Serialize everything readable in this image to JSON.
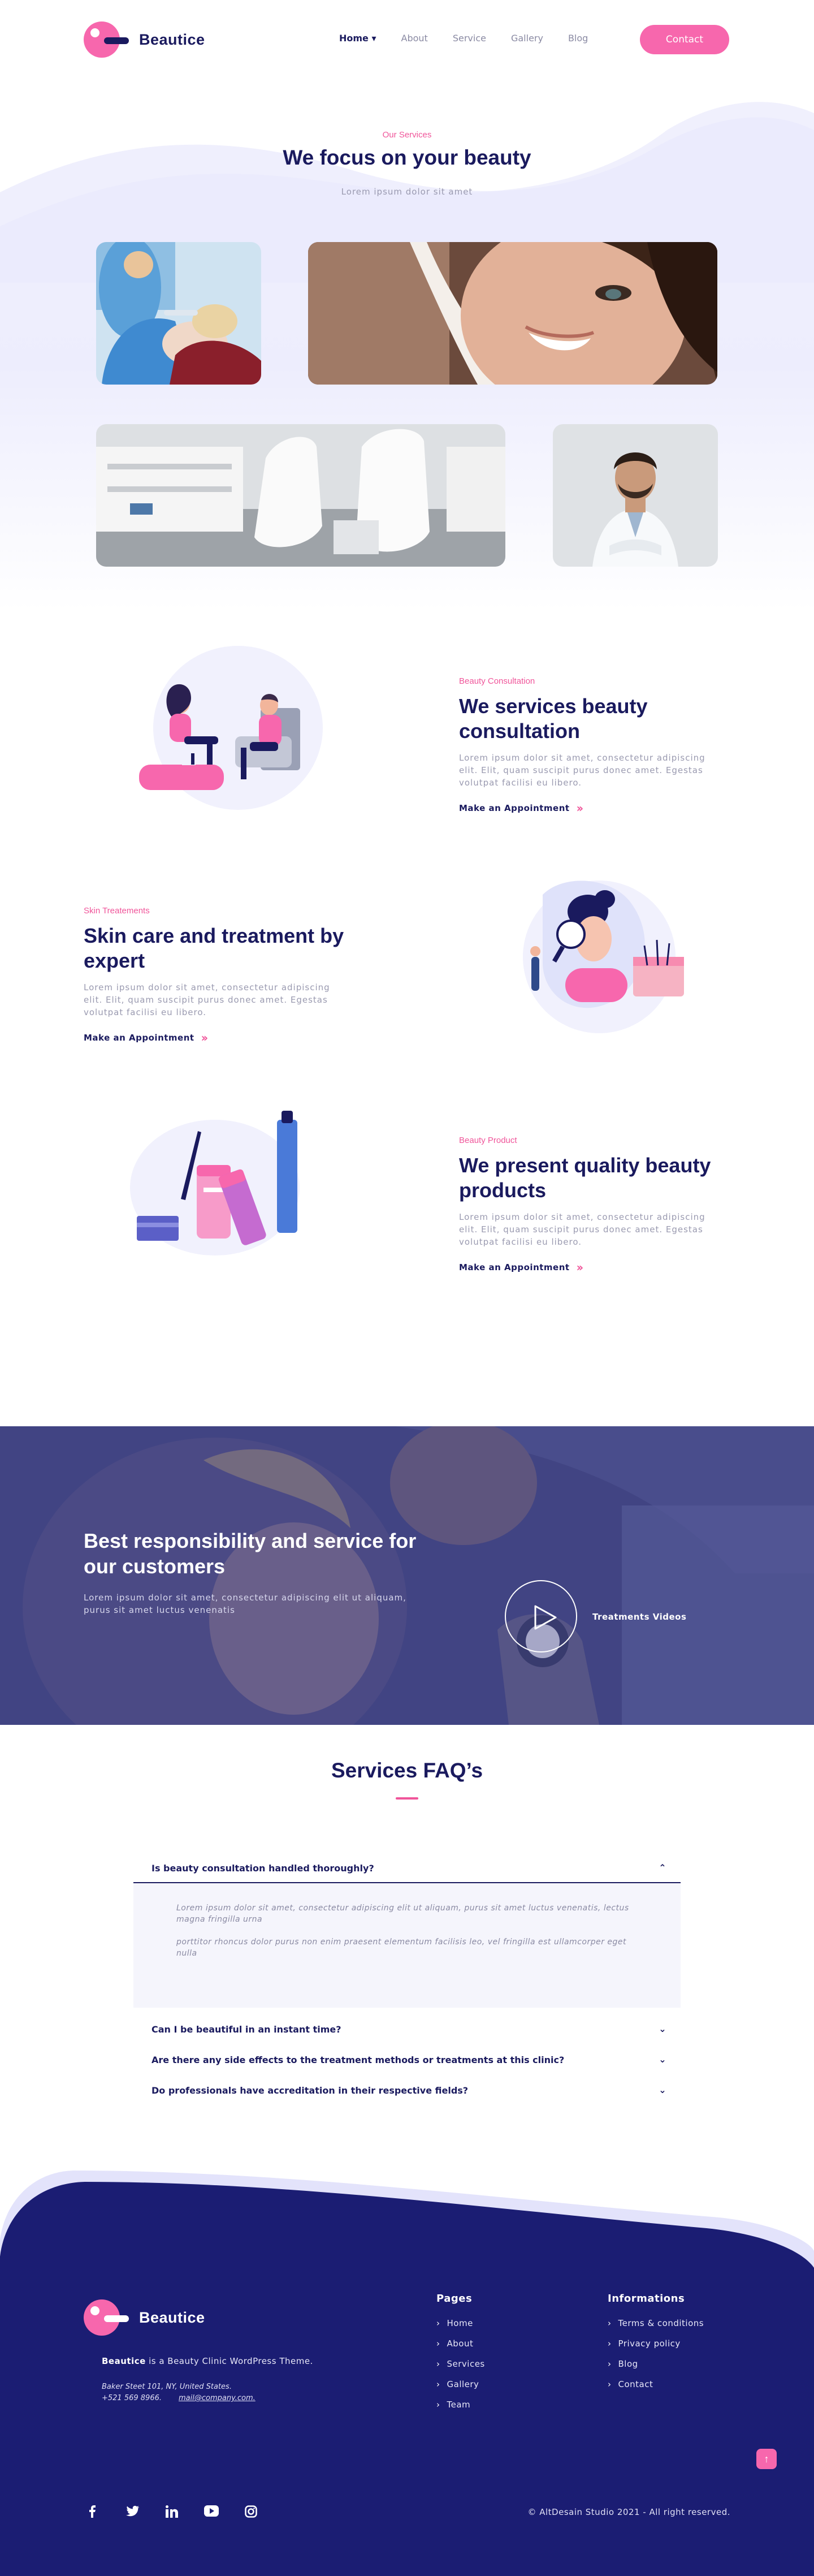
{
  "nav": {
    "brand": "Beautice",
    "items": [
      {
        "label": "Home",
        "active": true,
        "has_dropdown": true
      },
      {
        "label": "About"
      },
      {
        "label": "Service"
      },
      {
        "label": "Gallery"
      },
      {
        "label": "Blog"
      }
    ],
    "home_label": "Home ▾",
    "contact_label": "Contact"
  },
  "services": {
    "eyebrow": "Our Services",
    "title": "We focus on your beauty",
    "subtitle": "Lorem ipsum dolor sit amet"
  },
  "features": [
    {
      "tag": "Beauty Consultation",
      "title": "We services beauty consultation",
      "text": "Lorem ipsum dolor sit amet, consectetur adipiscing elit. Elit, quam suscipit purus donec amet. Egestas volutpat facilisi eu libero.",
      "link": "Make an Appointment"
    },
    {
      "tag": "Skin Treatements",
      "title": "Skin care and treatment by expert",
      "text": "Lorem ipsum dolor sit amet, consectetur adipiscing elit. Elit, quam suscipit purus donec amet. Egestas volutpat facilisi eu libero.",
      "link": "Make an Appointment"
    },
    {
      "tag": "Beauty Product",
      "title": "We present quality beauty products",
      "text": "Lorem ipsum dolor sit amet, consectetur adipiscing elit. Elit, quam suscipit purus donec amet. Egestas volutpat facilisi eu libero.",
      "link": "Make an Appointment"
    }
  ],
  "banner": {
    "title": "Best responsibility and service for our customers",
    "text": "Lorem ipsum dolor sit amet, consectetur adipiscing elit ut aliquam, purus sit amet luctus venenatis",
    "video_label": "Treatments Videos"
  },
  "faq": {
    "title": "Services FAQ’s",
    "items": [
      {
        "question": "Is beauty consultation handled thoroughly?",
        "open": true,
        "answer_1": "Lorem ipsum dolor sit amet, consectetur adipiscing elit ut aliquam, purus sit amet luctus venenatis, lectus magna fringilla urna",
        "answer_2": "porttitor rhoncus dolor purus non enim praesent elementum facilisis leo, vel fringilla est ullamcorper eget nulla"
      },
      {
        "question": "Can I be beautiful in an instant time?"
      },
      {
        "question": "Are there any side effects to the treatment methods or treatments at this clinic?"
      },
      {
        "question": "Do professionals have accreditation in their respective fields?"
      }
    ]
  },
  "footer": {
    "brand": "Beautice",
    "desc_brand": "Beautice",
    "desc_rest": " is a Beauty Clinic WordPress Theme.",
    "address": "Baker Steet 101, NY, United States.",
    "phone": "+521 569 8966.",
    "email": "mail@company.com.",
    "pages_title": "Pages",
    "pages": [
      "Home",
      "About",
      "Services",
      "Gallery",
      "Team"
    ],
    "info_title": "Informations",
    "info": [
      "Terms & conditions",
      "Privacy policy",
      "Blog",
      "Contact"
    ],
    "socials": [
      "facebook-icon",
      "twitter-icon",
      "linkedin-icon",
      "youtube-icon",
      "instagram-icon"
    ],
    "copyright": "© AltDesain Studio 2021 - All right reserved."
  },
  "colors": {
    "navy": "#1a1a5e",
    "pink": "#f767ad",
    "footer_bg": "#1b1d73",
    "lavender": "#ededfd"
  }
}
